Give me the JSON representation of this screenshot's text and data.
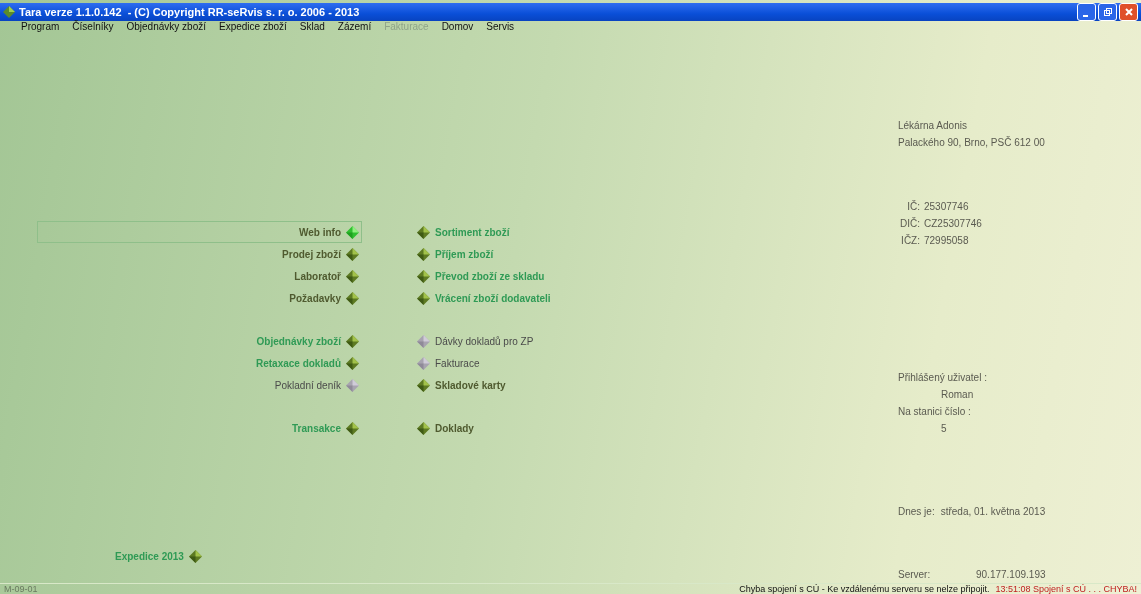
{
  "window": {
    "title": "Tara verze 1.1.0.142  - (C) Copyright RR-seRvis s. r. o. 2006 - 2013"
  },
  "menu": [
    {
      "label": "Program",
      "disabled": false
    },
    {
      "label": "Číselníky",
      "disabled": false
    },
    {
      "label": "Objednávky zboží",
      "disabled": false
    },
    {
      "label": "Expedice zboží",
      "disabled": false
    },
    {
      "label": "Sklad",
      "disabled": false
    },
    {
      "label": "Zázemí",
      "disabled": false
    },
    {
      "label": "Fakturace",
      "disabled": true
    },
    {
      "label": "Domov",
      "disabled": false
    },
    {
      "label": "Servis",
      "disabled": false
    }
  ],
  "groups": [
    {
      "left": [
        {
          "label": "Web info",
          "kind": "plain",
          "disabled": false,
          "selected": true
        },
        {
          "label": "Prodej zboží",
          "kind": "plain",
          "disabled": false,
          "selected": false
        },
        {
          "label": "Laboratoř",
          "kind": "plain",
          "disabled": false,
          "selected": false
        },
        {
          "label": "Požadavky",
          "kind": "plain",
          "disabled": false,
          "selected": false
        }
      ],
      "right": [
        {
          "label": "Sortiment zboží",
          "kind": "accent",
          "disabled": false,
          "selected": false
        },
        {
          "label": "Příjem zboží",
          "kind": "accent",
          "disabled": false,
          "selected": false
        },
        {
          "label": "Převod zboží ze skladu",
          "kind": "accent",
          "disabled": false,
          "selected": false
        },
        {
          "label": "Vrácení zboží dodavateli",
          "kind": "accent",
          "disabled": false,
          "selected": false
        }
      ]
    },
    {
      "left": [
        {
          "label": "Objednávky zboží",
          "kind": "accent",
          "disabled": false,
          "selected": false
        },
        {
          "label": "Retaxace dokladů",
          "kind": "accent",
          "disabled": false,
          "selected": false
        },
        {
          "label": "Pokladní deník",
          "kind": "plain",
          "disabled": true,
          "selected": false
        }
      ],
      "right": [
        {
          "label": "Dávky dokladů pro ZP",
          "kind": "plain",
          "disabled": true,
          "selected": false
        },
        {
          "label": "Fakturace",
          "kind": "plain",
          "disabled": true,
          "selected": false
        },
        {
          "label": "Skladové karty",
          "kind": "plain",
          "disabled": false,
          "selected": false
        }
      ]
    },
    {
      "left": [
        {
          "label": "Transakce",
          "kind": "accent",
          "disabled": false,
          "selected": false
        }
      ],
      "right": [
        {
          "label": "Doklady",
          "kind": "plain",
          "disabled": false,
          "selected": false
        }
      ]
    }
  ],
  "expedice": {
    "label": "Expedice 2013"
  },
  "info": {
    "name": "Lékárna Adonis",
    "address": "Palackého 90, Brno, PSČ 612 00",
    "ids": [
      {
        "label": "IČ:",
        "value": "25307746"
      },
      {
        "label": "DIČ:",
        "value": "CZ25307746"
      },
      {
        "label": "IČZ:",
        "value": "72995058"
      }
    ],
    "user_label": "Přihlášený uživatel :",
    "user": "Roman",
    "station_label": "Na stanici číslo :",
    "station": "5",
    "date_label": "Dnes je:",
    "date": "středa, 01. května 2013",
    "server_label": "Server:",
    "server": "90.177.109.193"
  },
  "status_bar": {
    "code": "M-09-01",
    "message": "Chyba spojení s CÚ - Ke vzdálenému serveru se nelze připojit.",
    "error": "13:51:08 Spojení s CÚ . . . CHYBA!"
  }
}
